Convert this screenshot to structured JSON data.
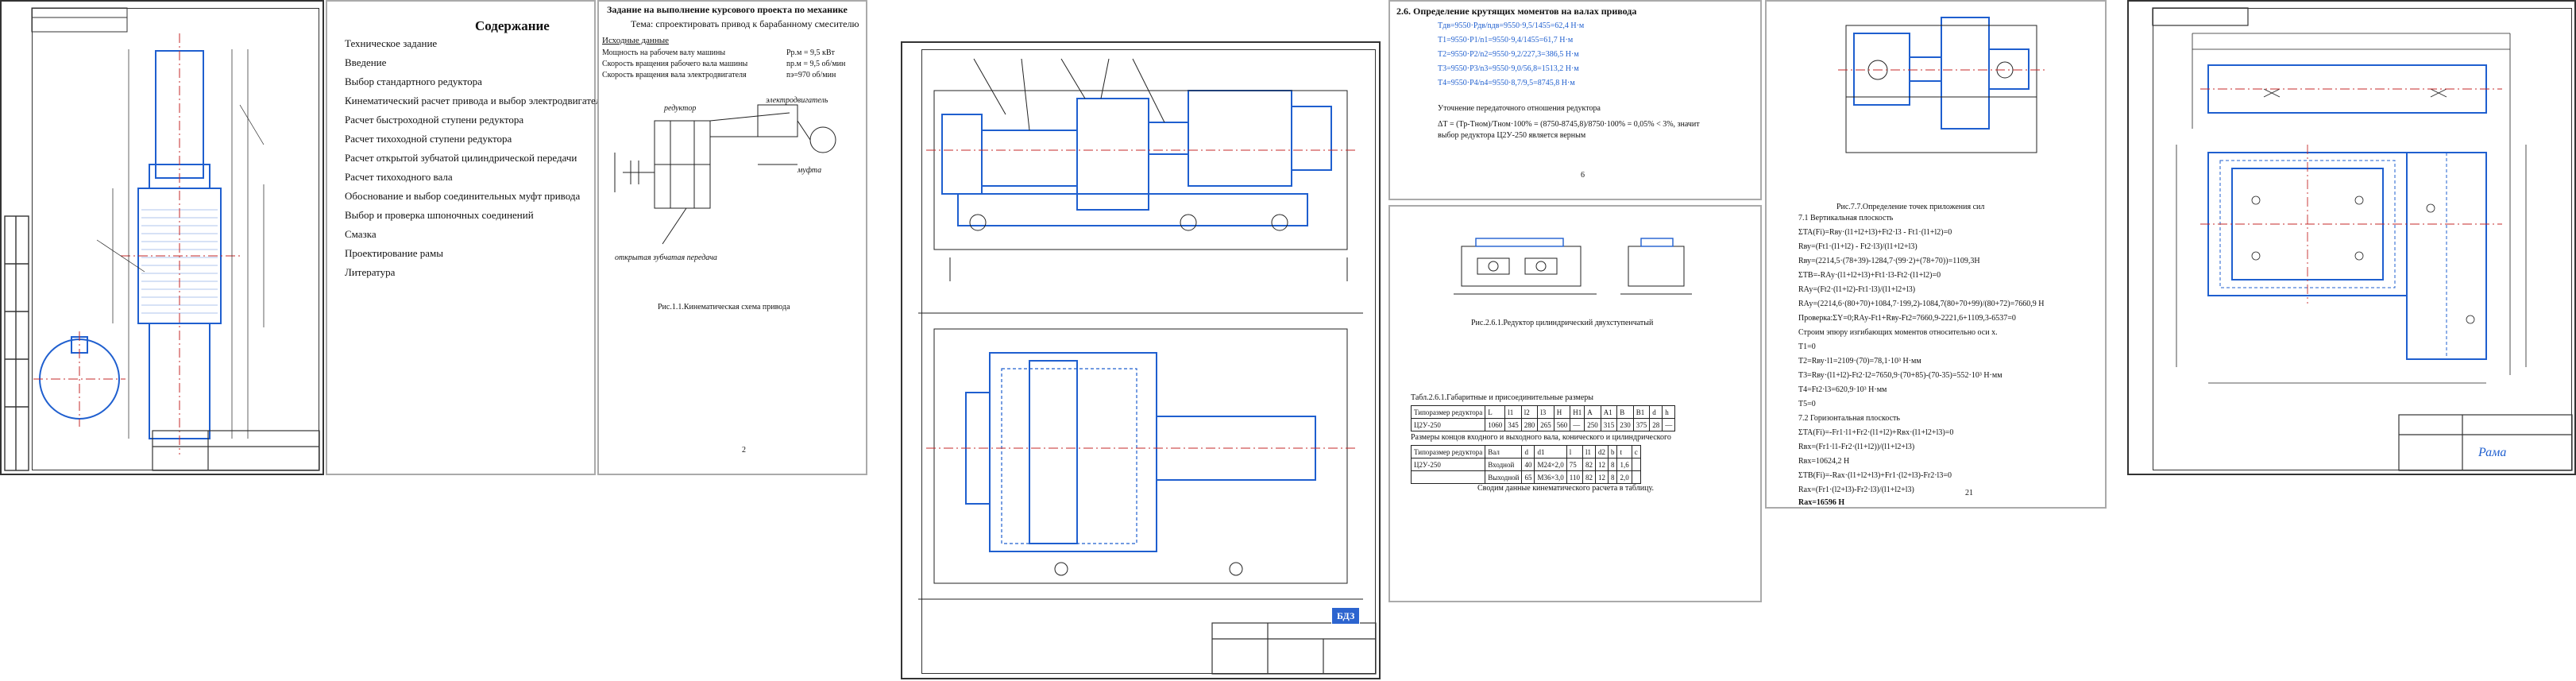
{
  "contents": {
    "title": "Содержание",
    "items": [
      "Техническое задание",
      "Введение",
      "Выбор стандартного редуктора",
      "Кинематический расчет привода и выбор электродвигателя",
      "Расчет быстроходной ступени редуктора",
      "Расчет тихоходной ступени редуктора",
      "Расчет открытой зубчатой цилиндрической передачи",
      "Расчет тихоходного вала",
      "Обоснование и выбор соединительных муфт привода",
      "Выбор и проверка шпоночных соединений",
      "Смазка",
      "Проектирование рамы",
      "Литература"
    ]
  },
  "task": {
    "title": "Задание на выполнение курсового проекта по механике",
    "subtitle": "Тема: спроектировать привод к барабанному смесителю",
    "initial_data_label": "Исходные данные",
    "rows": [
      {
        "label": "Мощность на рабочем валу машины",
        "value": "Рр.м = 9,5 кВт"
      },
      {
        "label": "Скорость вращения рабочего вала машины",
        "value": "np.м = 9,5 об/мин"
      },
      {
        "label": "Скорость вращения вала электродвигателя",
        "value": "nэ=970 об/мин"
      }
    ],
    "scheme_labels": {
      "reducer": "редуктор",
      "motor": "электродвигатель",
      "open_gear": "открытая зубчатая передача",
      "coupling": "муфта"
    },
    "figure_caption": "Рис.1.1.Кинематическая схема привода",
    "page_number": "2"
  },
  "torques": {
    "heading": "2.6.  Определение крутящих моментов на валах привода",
    "lines": [
      "Тдв=9550·Рдв/nдв=9550·9,5/1455=62,4 Н·м",
      "Т1=9550·Р1/n1=9550·9,4/1455=61,7 Н·м",
      "Т2=9550·Р2/n2=9550·9,2/227,3=386,5 Н·м",
      "Т3=9550·Р3/n3=9550·9,0/56,8=1513,2 Н·м",
      "Т4=9550·Р4/n4=9550·8,7/9,5=8745,8 Н·м"
    ],
    "note_title": "Уточнение передаточного отношения редуктора",
    "note_lines": [
      "ΔТ = (Тр-Тном)/Тном·100% = (8750-8745,8)/8750·100% = 0,05% < 3%, значит",
      "выбор редуктора Ц2У-250 является верным"
    ],
    "page_number": "6"
  },
  "reducer_fig": {
    "caption": "Рис.2.6.1.Редуктор цилиндрический двухступенчатый",
    "table_caption": "Табл.2.6.1.Габаритные и присоединительные размеры",
    "header": [
      "Типоразмер редуктора",
      "L",
      "l1",
      "l2",
      "l3",
      "H",
      "H1",
      "A",
      "A1",
      "B",
      "B1",
      "d",
      "h"
    ],
    "row": [
      "Ц2У-250",
      "1060",
      "345",
      "280",
      "265",
      "560",
      "—",
      "250",
      "315",
      "230",
      "375",
      "28",
      "—"
    ],
    "table2_caption": "Размеры концов входного и выходного вала, конического и цилиндрического",
    "table2_header": [
      "Типоразмер редуктора",
      "Вал",
      "d",
      "d1",
      "l",
      "l1",
      "d2",
      "b",
      "t",
      "c"
    ],
    "table2_rows": [
      [
        "Ц2У-250",
        "Входной",
        "40",
        "M24×2,0",
        "75",
        "82",
        "12",
        "8",
        "1,6"
      ],
      [
        "",
        "Выходной",
        "65",
        "M36×3,0",
        "110",
        "82",
        "12",
        "8",
        "2,0"
      ]
    ],
    "summary": "Сводим данные кинематического расчета в таблицу."
  },
  "calc": {
    "fig_caption": "Рис.7.7.Определение точек приложения сил",
    "vertical_title": "7.1 Вертикальная плоскость",
    "lines": [
      "ΣTA(Fi)=Rву·(l1+l2+l3)+Ft2·l3 - Ft1·(l1+l2)=0",
      "Rву=(Ft1·(l1+l2) - Ft2·l3)/(l1+l2+l3)",
      "Rву=(2214,5·(78+39)-1284,7·(99·2)+(78+70))=1109,3H",
      "ΣTB=-RАу·(l1+l2+l3)+Ft1·l3-Ft2·(l1+l2)=0",
      "RАу=(Ft2·(l1+l2)-Ft1·l3)/(l1+l2+l3)",
      "RАу=(2214,6·(80+70)+1084,7·199,2)-1084,7(80+70+99)/(80+72)=7660,9 Н",
      "Проверка:ΣY=0;RАу-Ft1+Rву-Ft2=7660,9-2221,6+1109,3-6537=0",
      "Строим эпюру изгибающих моментов относительно оси х.",
      "T1=0",
      "T2=Rву·l1=2109·(70)=78,1·10³ Н·мм",
      "T3=Rву·(l1+l2)-Ft2·l2=7650,9·(70+85)-(70-35)=552·10³ Н·мм",
      "T4=Ft2·l3=620,9·10³ Н·мм",
      "T5=0"
    ],
    "horizontal_title": "7.2 Горизонтальная плоскость",
    "lines2": [
      "ΣTA(Fi)=-Fr1·l1+Fr2·(l1+l2)+Rвх·(l1+l2+l3)=0",
      "Rвх=(Fr1·l1-Fr2·(l1+l2))/(l1+l2+l3)",
      "Rвх=10624,2 Н",
      "ΣTB(Fi)=-Rах·(l1+l2+l3)+Fr1·(l2+l3)-Fr2·l3=0",
      "Rах=(Fr1·(l2+l3)-Fr2·l3)/(l1+l2+l3)",
      "Rах=16596 Н"
    ],
    "page_number": "21"
  },
  "drawings": {
    "shaft_title": "Рама",
    "stamp_code": "БДЗ"
  }
}
